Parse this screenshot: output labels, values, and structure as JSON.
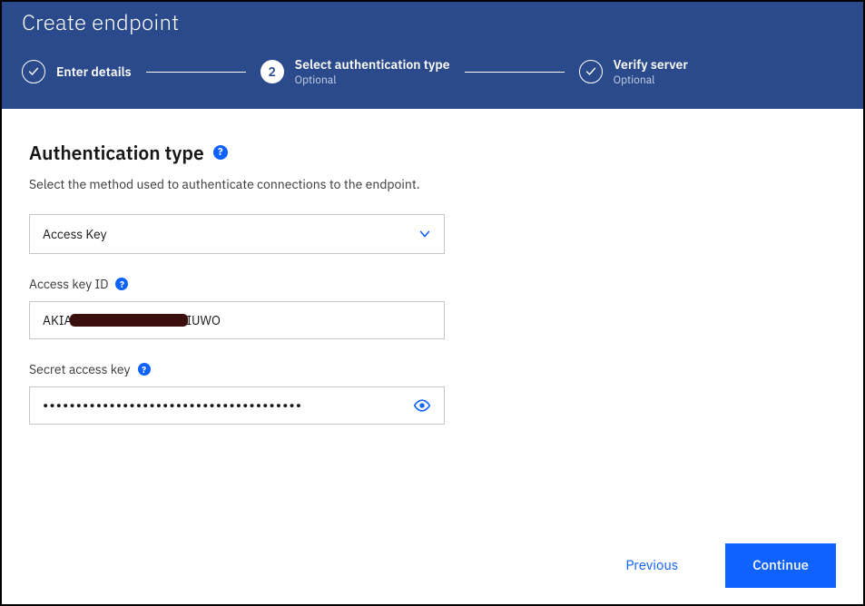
{
  "header": {
    "title": "Create endpoint"
  },
  "stepper": {
    "step1": {
      "label": "Enter details"
    },
    "step2": {
      "number": "2",
      "label": "Select authentication type",
      "sublabel": "Optional"
    },
    "step3": {
      "label": "Verify server",
      "sublabel": "Optional"
    }
  },
  "main": {
    "section_title": "Authentication type",
    "section_desc": "Select the method used to authenticate connections to the endpoint.",
    "auth_type_select": {
      "value": "Access Key"
    },
    "access_key_id": {
      "label": "Access key ID",
      "prefix": "AKIA",
      "suffix": "IUWO"
    },
    "secret_key": {
      "label": "Secret access key",
      "masked": "•••••••••••••••••••••••••••••••••••••••"
    }
  },
  "footer": {
    "previous": "Previous",
    "continue": "Continue"
  },
  "colors": {
    "header_bg": "#2a4a8b",
    "primary": "#0f62fe"
  }
}
